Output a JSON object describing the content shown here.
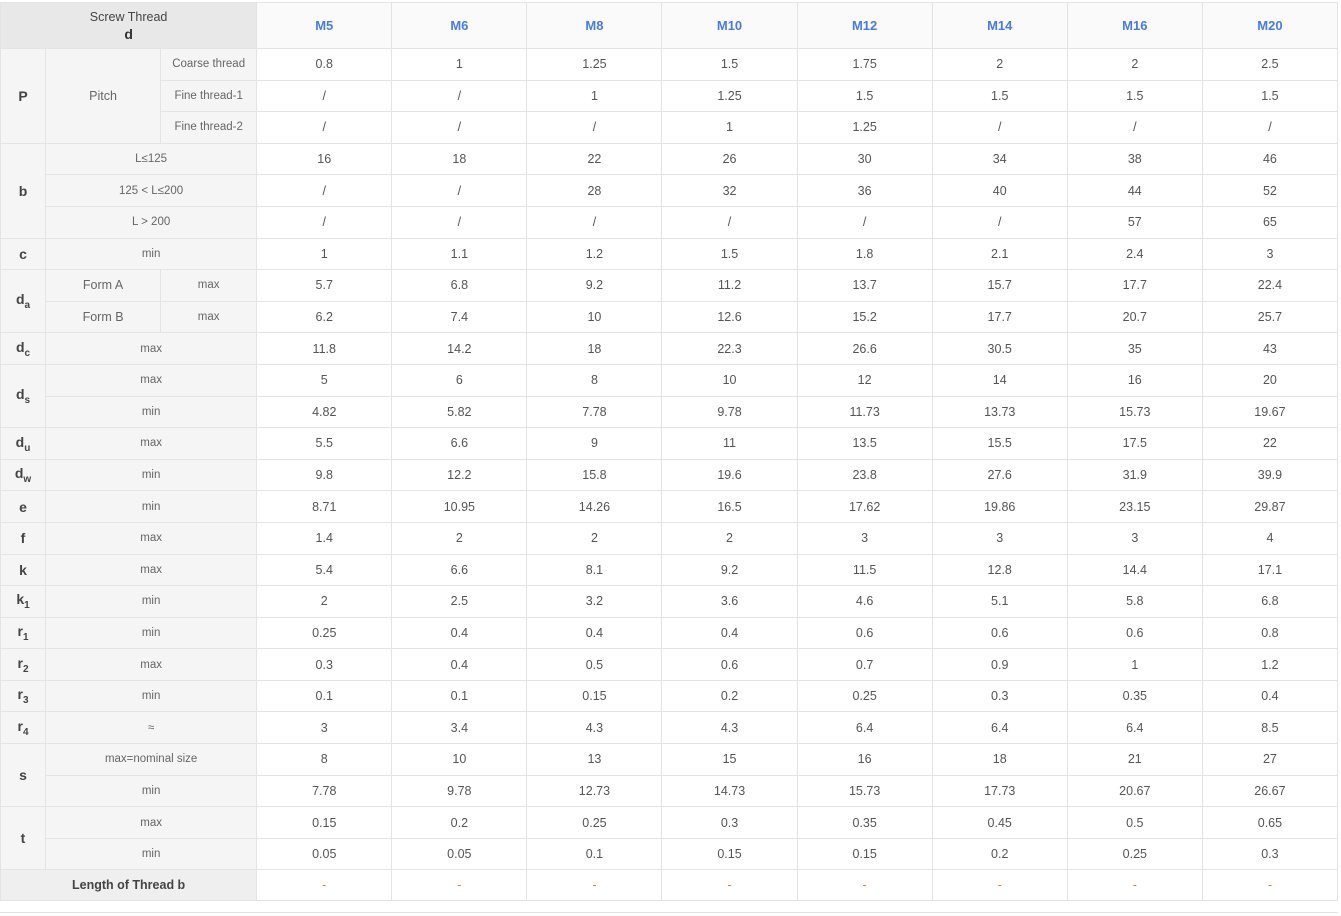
{
  "header": {
    "corner_title": "Screw Thread",
    "corner_symbol": "d",
    "sizes": [
      "M5",
      "M6",
      "M8",
      "M10",
      "M12",
      "M14",
      "M16",
      "M20"
    ]
  },
  "rows": {
    "p": {
      "symbol": "P",
      "label": "Pitch",
      "coarse": {
        "label": "Coarse thread",
        "values": [
          "0.8",
          "1",
          "1.25",
          "1.5",
          "1.75",
          "2",
          "2",
          "2.5"
        ]
      },
      "fine1": {
        "label": "Fine thread-1",
        "values": [
          "/",
          "/",
          "1",
          "1.25",
          "1.5",
          "1.5",
          "1.5",
          "1.5"
        ]
      },
      "fine2": {
        "label": "Fine thread-2",
        "values": [
          "/",
          "/",
          "/",
          "1",
          "1.25",
          "/",
          "/",
          "/"
        ]
      }
    },
    "b": {
      "symbol": "b",
      "r1": {
        "label": "L≤125",
        "values": [
          "16",
          "18",
          "22",
          "26",
          "30",
          "34",
          "38",
          "46"
        ]
      },
      "r2": {
        "label": "125 < L≤200",
        "values": [
          "/",
          "/",
          "28",
          "32",
          "36",
          "40",
          "44",
          "52"
        ]
      },
      "r3": {
        "label": "L > 200",
        "values": [
          "/",
          "/",
          "/",
          "/",
          "/",
          "/",
          "57",
          "65"
        ]
      }
    },
    "c": {
      "symbol": "c",
      "label": "min",
      "values": [
        "1",
        "1.1",
        "1.2",
        "1.5",
        "1.8",
        "2.1",
        "2.4",
        "3"
      ]
    },
    "da": {
      "symbol": "d",
      "sub": "a",
      "formA": {
        "label": "Form A",
        "qual": "max",
        "values": [
          "5.7",
          "6.8",
          "9.2",
          "11.2",
          "13.7",
          "15.7",
          "17.7",
          "22.4"
        ]
      },
      "formB": {
        "label": "Form B",
        "qual": "max",
        "values": [
          "6.2",
          "7.4",
          "10",
          "12.6",
          "15.2",
          "17.7",
          "20.7",
          "25.7"
        ]
      }
    },
    "dc": {
      "symbol": "d",
      "sub": "c",
      "label": "max",
      "values": [
        "11.8",
        "14.2",
        "18",
        "22.3",
        "26.6",
        "30.5",
        "35",
        "43"
      ]
    },
    "ds": {
      "symbol": "d",
      "sub": "s",
      "max": {
        "label": "max",
        "values": [
          "5",
          "6",
          "8",
          "10",
          "12",
          "14",
          "16",
          "20"
        ]
      },
      "min": {
        "label": "min",
        "values": [
          "4.82",
          "5.82",
          "7.78",
          "9.78",
          "11.73",
          "13.73",
          "15.73",
          "19.67"
        ]
      }
    },
    "du": {
      "symbol": "d",
      "sub": "u",
      "label": "max",
      "values": [
        "5.5",
        "6.6",
        "9",
        "11",
        "13.5",
        "15.5",
        "17.5",
        "22"
      ]
    },
    "dw": {
      "symbol": "d",
      "sub": "w",
      "label": "min",
      "values": [
        "9.8",
        "12.2",
        "15.8",
        "19.6",
        "23.8",
        "27.6",
        "31.9",
        "39.9"
      ]
    },
    "e": {
      "symbol": "e",
      "label": "min",
      "values": [
        "8.71",
        "10.95",
        "14.26",
        "16.5",
        "17.62",
        "19.86",
        "23.15",
        "29.87"
      ]
    },
    "f": {
      "symbol": "f",
      "label": "max",
      "values": [
        "1.4",
        "2",
        "2",
        "2",
        "3",
        "3",
        "3",
        "4"
      ]
    },
    "k": {
      "symbol": "k",
      "label": "max",
      "values": [
        "5.4",
        "6.6",
        "8.1",
        "9.2",
        "11.5",
        "12.8",
        "14.4",
        "17.1"
      ]
    },
    "k1": {
      "symbol": "k",
      "sub": "1",
      "label": "min",
      "values": [
        "2",
        "2.5",
        "3.2",
        "3.6",
        "4.6",
        "5.1",
        "5.8",
        "6.8"
      ]
    },
    "r1": {
      "symbol": "r",
      "sub": "1",
      "label": "min",
      "values": [
        "0.25",
        "0.4",
        "0.4",
        "0.4",
        "0.6",
        "0.6",
        "0.6",
        "0.8"
      ]
    },
    "r2": {
      "symbol": "r",
      "sub": "2",
      "label": "max",
      "values": [
        "0.3",
        "0.4",
        "0.5",
        "0.6",
        "0.7",
        "0.9",
        "1",
        "1.2"
      ]
    },
    "r3": {
      "symbol": "r",
      "sub": "3",
      "label": "min",
      "values": [
        "0.1",
        "0.1",
        "0.15",
        "0.2",
        "0.25",
        "0.3",
        "0.35",
        "0.4"
      ]
    },
    "r4": {
      "symbol": "r",
      "sub": "4",
      "label": "≈",
      "values": [
        "3",
        "3.4",
        "4.3",
        "4.3",
        "6.4",
        "6.4",
        "6.4",
        "8.5"
      ]
    },
    "s": {
      "symbol": "s",
      "max": {
        "label": "max=nominal size",
        "values": [
          "8",
          "10",
          "13",
          "15",
          "16",
          "18",
          "21",
          "27"
        ]
      },
      "min": {
        "label": "min",
        "values": [
          "7.78",
          "9.78",
          "12.73",
          "14.73",
          "15.73",
          "17.73",
          "20.67",
          "26.67"
        ]
      }
    },
    "t": {
      "symbol": "t",
      "max": {
        "label": "max",
        "values": [
          "0.15",
          "0.2",
          "0.25",
          "0.3",
          "0.35",
          "0.45",
          "0.5",
          "0.65"
        ]
      },
      "min": {
        "label": "min",
        "values": [
          "0.05",
          "0.05",
          "0.1",
          "0.15",
          "0.15",
          "0.2",
          "0.25",
          "0.3"
        ]
      }
    },
    "thread_length": {
      "label": "Length of Thread b",
      "values": [
        "-",
        "-",
        "-",
        "-",
        "-",
        "-",
        "-",
        "-"
      ]
    }
  }
}
